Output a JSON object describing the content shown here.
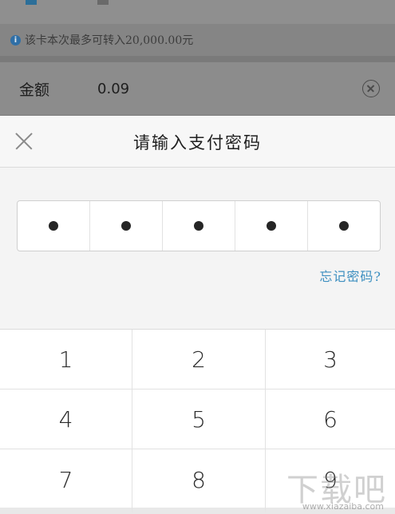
{
  "background": {
    "notice": "该卡本次最多可转入20,000.00元",
    "amount_label": "金额",
    "amount_value": "0.09"
  },
  "sheet": {
    "title": "请输入支付密码",
    "pin_length": 5,
    "pin_entered": 5,
    "forgot_label": "忘记密码?"
  },
  "keypad": {
    "keys": [
      "1",
      "2",
      "3",
      "4",
      "5",
      "6",
      "7",
      "8",
      "9"
    ]
  },
  "watermark": {
    "text": "下载吧",
    "url": "www.xiazaiba.com"
  },
  "colors": {
    "accent": "#3d8fc0",
    "overlay": "#7a7a7a"
  }
}
